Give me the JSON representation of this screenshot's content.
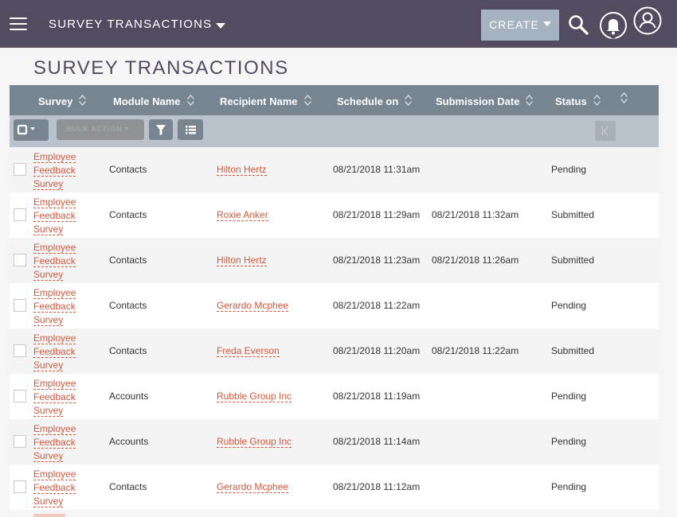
{
  "navbar": {
    "module_title": "SURVEY TRANSACTIONS",
    "create_label": "CREATE",
    "icons": [
      "menu-icon",
      "search-icon",
      "bell-icon",
      "user-icon"
    ],
    "colors": {
      "navbar_bg": "#534c61",
      "create_bg": "#a5b3c1"
    }
  },
  "page": {
    "title": "SURVEY TRANSACTIONS"
  },
  "table": {
    "columns": [
      "Survey",
      "Module Name",
      "Recipient Name",
      "Schedule on",
      "Submission Date",
      "Status"
    ],
    "toolbar": {
      "bulk_action_label": "BULK ACTION"
    },
    "rows": [
      {
        "survey": "Employee Feedback Survey",
        "module": "Contacts",
        "recipient": "Hilton Hertz",
        "schedule": "08/21/2018 11:31am",
        "submission": "",
        "status": "Pending"
      },
      {
        "survey": "Employee Feedback Survey",
        "module": "Contacts",
        "recipient": "Roxie Anker",
        "schedule": "08/21/2018 11:29am",
        "submission": "08/21/2018 11:32am",
        "status": "Submitted"
      },
      {
        "survey": "Employee Feedback Survey",
        "module": "Contacts",
        "recipient": "Hilton Hertz",
        "schedule": "08/21/2018 11:23am",
        "submission": "08/21/2018 11:26am",
        "status": "Submitted"
      },
      {
        "survey": "Employee Feedback Survey",
        "module": "Contacts",
        "recipient": "Gerardo Mcphee",
        "schedule": "08/21/2018 11:22am",
        "submission": "",
        "status": "Pending"
      },
      {
        "survey": "Employee Feedback Survey",
        "module": "Contacts",
        "recipient": "Freda Everson",
        "schedule": "08/21/2018 11:20am",
        "submission": "08/21/2018 11:22am",
        "status": "Submitted"
      },
      {
        "survey": "Employee Feedback Survey",
        "module": "Accounts",
        "recipient": "Rubble Group Inc",
        "schedule": "08/21/2018 11:19am",
        "submission": "",
        "status": "Pending"
      },
      {
        "survey": "Employee Feedback Survey",
        "module": "Accounts",
        "recipient": "Rubble Group Inc",
        "schedule": "08/21/2018 11:14am",
        "submission": "",
        "status": "Pending"
      },
      {
        "survey": "Employee Feedback Survey",
        "module": "Contacts",
        "recipient": "Gerardo Mcphee",
        "schedule": "08/21/2018 11:12am",
        "submission": "",
        "status": "Pending"
      }
    ]
  }
}
